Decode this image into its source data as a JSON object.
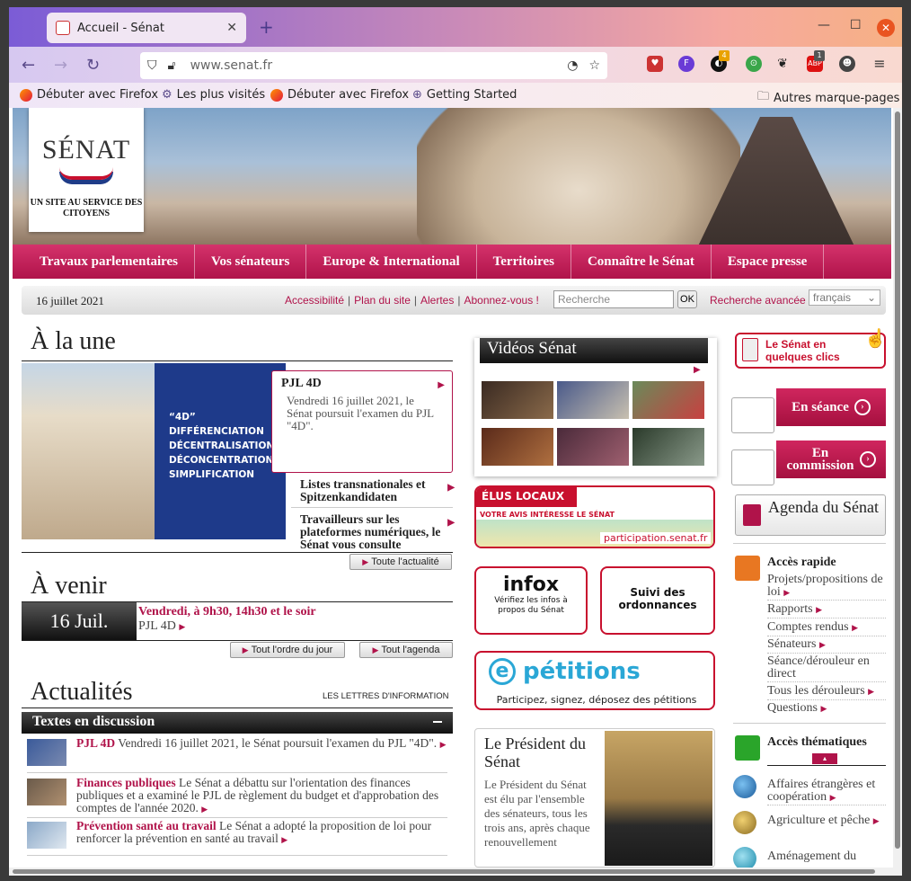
{
  "browser": {
    "tab_title": "Accueil - Sénat",
    "url": "www.senat.fr",
    "bookmarks": [
      "Débuter avec Firefox",
      "Les plus visités",
      "Débuter avec Firefox",
      "Getting Started"
    ],
    "other_bookmarks": "Autres marque-pages",
    "ext_badges": {
      "count1": "4",
      "count2": "1"
    }
  },
  "site": {
    "logo_text": "SÉNAT",
    "logo_tagline": "UN SITE AU SERVICE DES CITOYENS",
    "menu": [
      "Travaux parlementaires",
      "Vos sénateurs",
      "Europe & International",
      "Territoires",
      "Connaître le Sénat",
      "Espace presse"
    ],
    "date": "16 juillet 2021",
    "util_links": [
      "Accessibilité",
      "Plan du site",
      "Alertes",
      "Abonnez-vous !"
    ],
    "search_placeholder": "Recherche",
    "ok": "OK",
    "advanced": "Recherche avancée",
    "language": "français"
  },
  "une": {
    "heading": "À la une",
    "img_text": [
      "“4D”",
      "DIFFÉRENCIATION",
      "DÉCENTRALISATION",
      "DÉCONCENTRATION",
      "SIMPLIFICATION"
    ],
    "callout_title": "PJL 4D",
    "callout_desc": "Vendredi 16 juillet 2021, le Sénat poursuit l'examen du PJL \"4D\".",
    "items": [
      "Listes transnationales et Spitzenkandidaten",
      "Travailleurs sur les plateformes numériques, le Sénat vous consulte"
    ],
    "all_news": "Toute l'actualité"
  },
  "avenir": {
    "heading": "À venir",
    "date": "16 Juil.",
    "when": "Vendredi, à 9h30, 14h30 et le soir",
    "what": "PJL 4D",
    "order": "Tout l'ordre du jour",
    "agenda": "Tout l'agenda"
  },
  "actualites": {
    "heading": "Actualités",
    "letters": "LES LETTRES D'INFORMATION",
    "bar": "Textes en discussion",
    "items": [
      {
        "title": "PJL 4D",
        "text": "Vendredi 16 juillet 2021, le Sénat poursuit l'examen du PJL \"4D\"."
      },
      {
        "title": "Finances publiques",
        "text": "Le Sénat a débattu sur l'orientation des finances publiques et a examiné le PJL de règlement du budget et d'approbation des comptes de l'année 2020."
      },
      {
        "title": "Prévention santé au travail",
        "text": "Le Sénat a adopté la proposition de loi pour renforcer la prévention en santé au travail"
      }
    ]
  },
  "middle": {
    "videos": "Vidéos Sénat",
    "elus_title": "ÉLUS LOCAUX",
    "elus_sub": "VOTRE AVIS INTÉRESSE LE SÉNAT",
    "elus_url": "participation.senat.fr",
    "infox_title": "infox",
    "infox_sub": "Vérifiez les infos à propos du Sénat",
    "ordo": "Suivi des ordonnances",
    "petitions_title": "pétitions",
    "petitions_sub": "Participez, signez, déposez des pétitions",
    "pres_title": "Le Président du Sénat",
    "pres_desc": "Le Président du Sénat est élu par l'ensemble des sénateurs, tous les trois ans, après chaque renouvellement"
  },
  "right": {
    "clics": "Le Sénat en quelques clics",
    "seance": "En séance",
    "commission": "En commission",
    "agenda": "Agenda du Sénat",
    "rapide": "Accès rapide",
    "rapide_links": [
      "Projets/propositions de loi",
      "Rapports",
      "Comptes rendus",
      "Sénateurs",
      "Séance/dérouleur en direct",
      "Tous les dérouleurs",
      "Questions"
    ],
    "thema": "Accès thématiques",
    "thema_links": [
      "Affaires étrangères et coopération",
      "Agriculture et pêche",
      "Aménagement du"
    ]
  }
}
